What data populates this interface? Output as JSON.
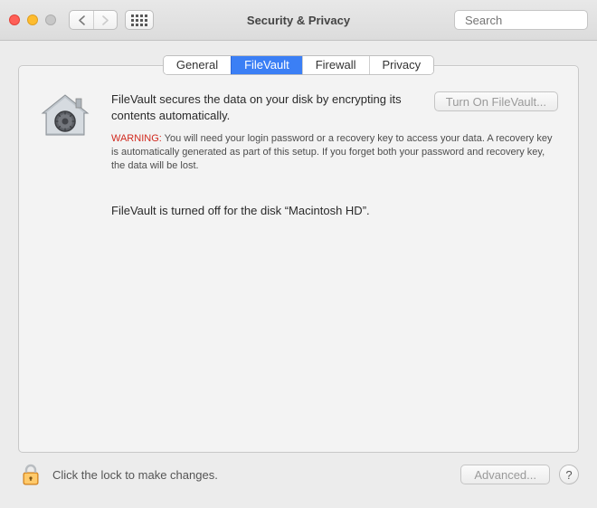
{
  "window": {
    "title": "Security & Privacy"
  },
  "toolbar": {
    "search_placeholder": "Search"
  },
  "tabs": {
    "general": "General",
    "filevault": "FileVault",
    "firewall": "Firewall",
    "privacy": "Privacy",
    "active": "filevault"
  },
  "filevault": {
    "description": "FileVault secures the data on your disk by encrypting its contents automatically.",
    "turn_on_label": "Turn On FileVault...",
    "warning_label": "WARNING:",
    "warning_text": "You will need your login password or a recovery key to access your data. A recovery key is automatically generated as part of this setup. If you forget both your password and recovery key, the data will be lost.",
    "status": "FileVault is turned off for the disk “Macintosh HD”."
  },
  "footer": {
    "lock_text": "Click the lock to make changes.",
    "advanced_label": "Advanced...",
    "help_label": "?"
  }
}
